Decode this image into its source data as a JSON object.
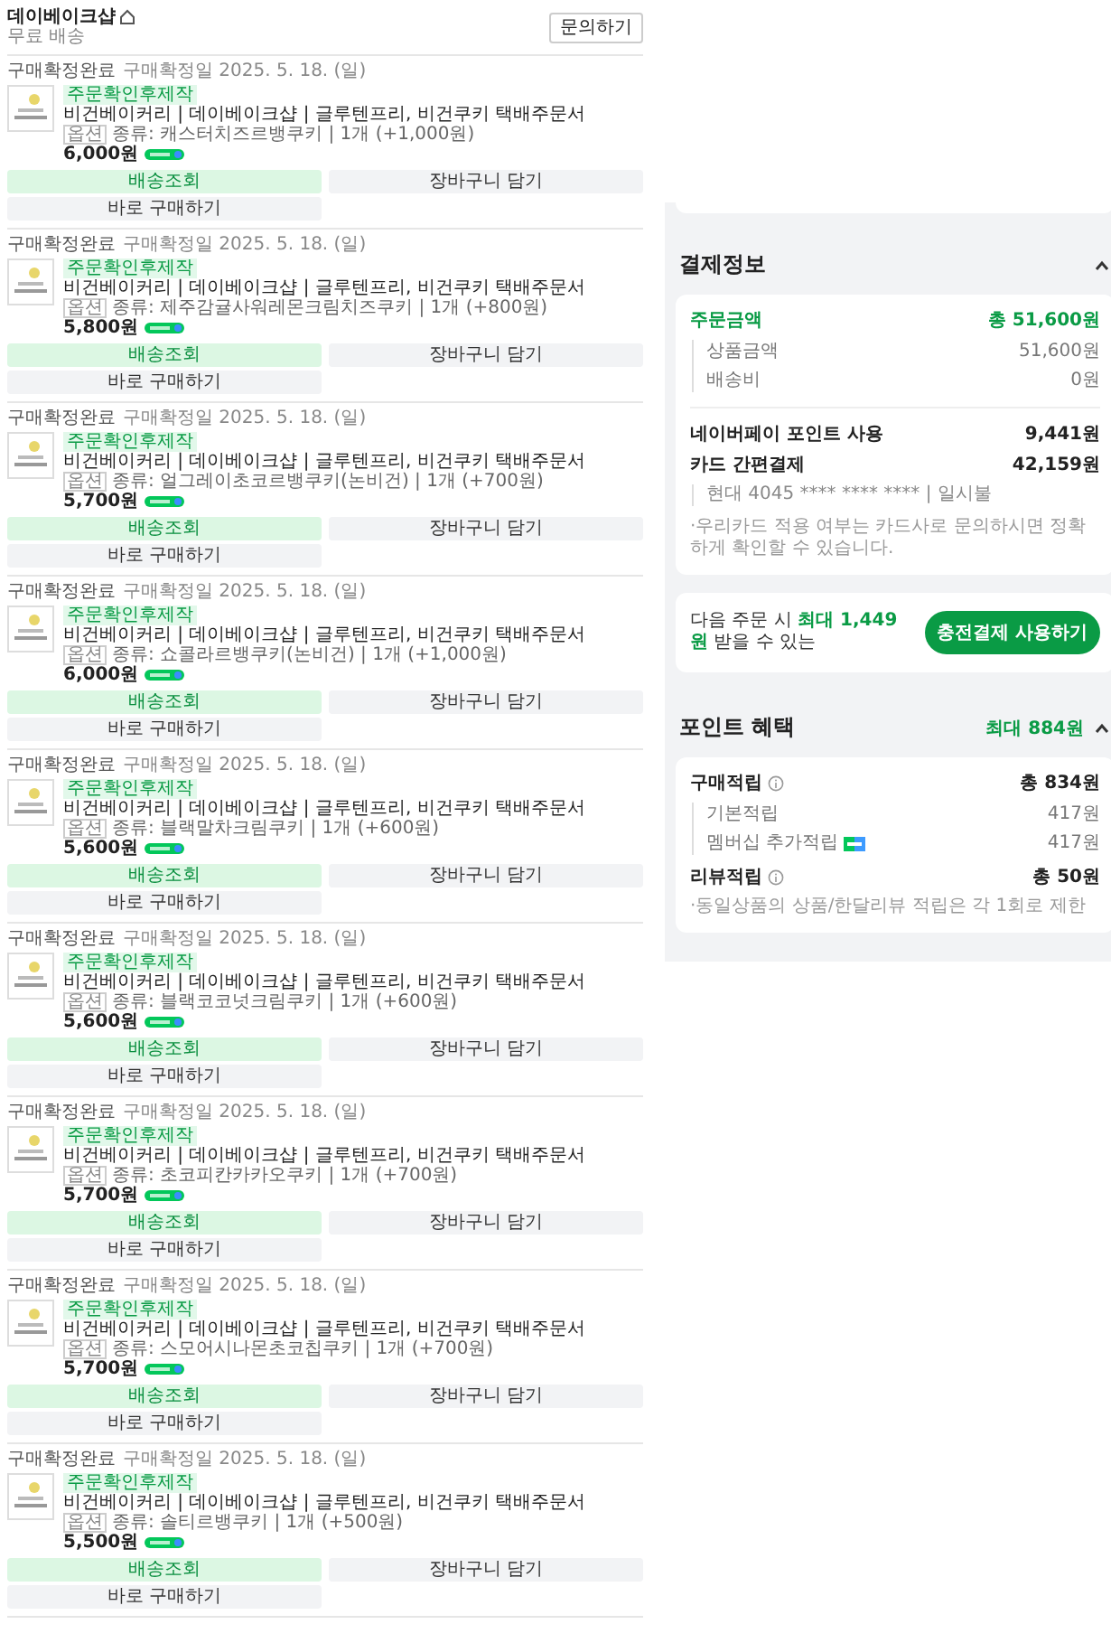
{
  "store": {
    "name": "데이베이크샵",
    "shipping": "무료 배송",
    "inquiry_button": "문의하기"
  },
  "orders": [
    {
      "status": "구매확정완료",
      "confirmed_date": "구매확정일 2025. 5. 18. (일)",
      "badge": "주문확인후제작",
      "title": "비건베이커리 | 데이베이크샵 | 글루텐프리, 비건쿠키 택배주문서",
      "option_tag": "옵션",
      "option": "종류: 캐스터치즈르뱅쿠키 | 1개 (+1,000원)",
      "price": "6,000원",
      "buttons": [
        "배송조회",
        "장바구니 담기",
        "바로 구매하기"
      ]
    },
    {
      "status": "구매확정완료",
      "confirmed_date": "구매확정일 2025. 5. 18. (일)",
      "badge": "주문확인후제작",
      "title": "비건베이커리 | 데이베이크샵 | 글루텐프리, 비건쿠키 택배주문서",
      "option_tag": "옵션",
      "option": "종류: 제주감귤사워레몬크림치즈쿠키 | 1개 (+800원)",
      "price": "5,800원",
      "buttons": [
        "배송조회",
        "장바구니 담기",
        "바로 구매하기"
      ]
    },
    {
      "status": "구매확정완료",
      "confirmed_date": "구매확정일 2025. 5. 18. (일)",
      "badge": "주문확인후제작",
      "title": "비건베이커리 | 데이베이크샵 | 글루텐프리, 비건쿠키 택배주문서",
      "option_tag": "옵션",
      "option": "종류: 얼그레이초코르뱅쿠키(논비건) | 1개 (+700원)",
      "price": "5,700원",
      "buttons": [
        "배송조회",
        "장바구니 담기",
        "바로 구매하기"
      ]
    },
    {
      "status": "구매확정완료",
      "confirmed_date": "구매확정일 2025. 5. 18. (일)",
      "badge": "주문확인후제작",
      "title": "비건베이커리 | 데이베이크샵 | 글루텐프리, 비건쿠키 택배주문서",
      "option_tag": "옵션",
      "option": "종류: 쇼콜라르뱅쿠키(논비건) | 1개 (+1,000원)",
      "price": "6,000원",
      "buttons": [
        "배송조회",
        "장바구니 담기",
        "바로 구매하기"
      ]
    },
    {
      "status": "구매확정완료",
      "confirmed_date": "구매확정일 2025. 5. 18. (일)",
      "badge": "주문확인후제작",
      "title": "비건베이커리 | 데이베이크샵 | 글루텐프리, 비건쿠키 택배주문서",
      "option_tag": "옵션",
      "option": "종류: 블랙말차크림쿠키 | 1개 (+600원)",
      "price": "5,600원",
      "buttons": [
        "배송조회",
        "장바구니 담기",
        "바로 구매하기"
      ]
    },
    {
      "status": "구매확정완료",
      "confirmed_date": "구매확정일 2025. 5. 18. (일)",
      "badge": "주문확인후제작",
      "title": "비건베이커리 | 데이베이크샵 | 글루텐프리, 비건쿠키 택배주문서",
      "option_tag": "옵션",
      "option": "종류: 블랙코코넛크림쿠키 | 1개 (+600원)",
      "price": "5,600원",
      "buttons": [
        "배송조회",
        "장바구니 담기",
        "바로 구매하기"
      ]
    },
    {
      "status": "구매확정완료",
      "confirmed_date": "구매확정일 2025. 5. 18. (일)",
      "badge": "주문확인후제작",
      "title": "비건베이커리 | 데이베이크샵 | 글루텐프리, 비건쿠키 택배주문서",
      "option_tag": "옵션",
      "option": "종류: 초코피칸카카오쿠키 | 1개 (+700원)",
      "price": "5,700원",
      "buttons": [
        "배송조회",
        "장바구니 담기",
        "바로 구매하기"
      ]
    },
    {
      "status": "구매확정완료",
      "confirmed_date": "구매확정일 2025. 5. 18. (일)",
      "badge": "주문확인후제작",
      "title": "비건베이커리 | 데이베이크샵 | 글루텐프리, 비건쿠키 택배주문서",
      "option_tag": "옵션",
      "option": "종류: 스모어시나몬초코칩쿠키 | 1개 (+700원)",
      "price": "5,700원",
      "buttons": [
        "배송조회",
        "장바구니 담기",
        "바로 구매하기"
      ]
    },
    {
      "status": "구매확정완료",
      "confirmed_date": "구매확정일 2025. 5. 18. (일)",
      "badge": "주문확인후제작",
      "title": "비건베이커리 | 데이베이크샵 | 글루텐프리, 비건쿠키 택배주문서",
      "option_tag": "옵션",
      "option": "종류: 솔티르뱅쿠키 | 1개 (+500원)",
      "price": "5,500원",
      "buttons": [
        "배송조회",
        "장바구니 담기",
        "바로 구매하기"
      ]
    }
  ],
  "payment": {
    "title": "결제정보",
    "expanded": true,
    "order_total": {
      "label": "주문금액",
      "value": "총 51,600원"
    },
    "breakdown": [
      {
        "label": "상품금액",
        "value": "51,600원"
      },
      {
        "label": "배송비",
        "value": "0원"
      }
    ],
    "methods": [
      {
        "label": "네이버페이 포인트 사용",
        "value": "9,441원"
      },
      {
        "label": "카드 간편결제",
        "value": "42,159원"
      }
    ],
    "card_detail": "현대 4045 **** **** **** | 일시불",
    "note": "·우리카드 적용 여부는 카드사로 문의하시면 정확하게 확인할 수 있습니다."
  },
  "promo": {
    "text": "다음 주문 시 **최대 1,449원** 받을 수 있는",
    "button": "충전결제 사용하기"
  },
  "points": {
    "title": "포인트 혜택",
    "summary": "최대 884원",
    "expanded": true,
    "groups": [
      {
        "label": "구매적립",
        "value": "총 834원",
        "items": [
          {
            "label": "기본적립",
            "value": "417원",
            "membership_badge": false
          },
          {
            "label": "멤버십 추가적립",
            "value": "417원",
            "membership_badge": true
          }
        ]
      },
      {
        "label": "리뷰적립",
        "value": "총 50원"
      }
    ],
    "note": "·동일상품의 상품/한달리뷰 적립은 각 1회로 제한"
  }
}
